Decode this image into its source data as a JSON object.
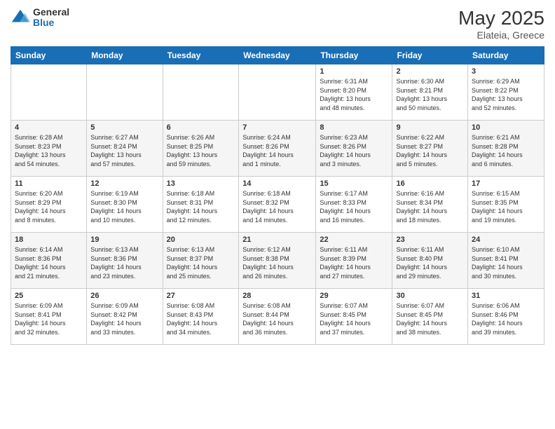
{
  "header": {
    "logo_general": "General",
    "logo_blue": "Blue",
    "month_year": "May 2025",
    "location": "Elateia, Greece"
  },
  "calendar": {
    "days_of_week": [
      "Sunday",
      "Monday",
      "Tuesday",
      "Wednesday",
      "Thursday",
      "Friday",
      "Saturday"
    ],
    "weeks": [
      [
        {
          "day": "",
          "info": ""
        },
        {
          "day": "",
          "info": ""
        },
        {
          "day": "",
          "info": ""
        },
        {
          "day": "",
          "info": ""
        },
        {
          "day": "1",
          "info": "Sunrise: 6:31 AM\nSunset: 8:20 PM\nDaylight: 13 hours\nand 48 minutes."
        },
        {
          "day": "2",
          "info": "Sunrise: 6:30 AM\nSunset: 8:21 PM\nDaylight: 13 hours\nand 50 minutes."
        },
        {
          "day": "3",
          "info": "Sunrise: 6:29 AM\nSunset: 8:22 PM\nDaylight: 13 hours\nand 52 minutes."
        }
      ],
      [
        {
          "day": "4",
          "info": "Sunrise: 6:28 AM\nSunset: 8:23 PM\nDaylight: 13 hours\nand 54 minutes."
        },
        {
          "day": "5",
          "info": "Sunrise: 6:27 AM\nSunset: 8:24 PM\nDaylight: 13 hours\nand 57 minutes."
        },
        {
          "day": "6",
          "info": "Sunrise: 6:26 AM\nSunset: 8:25 PM\nDaylight: 13 hours\nand 59 minutes."
        },
        {
          "day": "7",
          "info": "Sunrise: 6:24 AM\nSunset: 8:26 PM\nDaylight: 14 hours\nand 1 minute."
        },
        {
          "day": "8",
          "info": "Sunrise: 6:23 AM\nSunset: 8:26 PM\nDaylight: 14 hours\nand 3 minutes."
        },
        {
          "day": "9",
          "info": "Sunrise: 6:22 AM\nSunset: 8:27 PM\nDaylight: 14 hours\nand 5 minutes."
        },
        {
          "day": "10",
          "info": "Sunrise: 6:21 AM\nSunset: 8:28 PM\nDaylight: 14 hours\nand 6 minutes."
        }
      ],
      [
        {
          "day": "11",
          "info": "Sunrise: 6:20 AM\nSunset: 8:29 PM\nDaylight: 14 hours\nand 8 minutes."
        },
        {
          "day": "12",
          "info": "Sunrise: 6:19 AM\nSunset: 8:30 PM\nDaylight: 14 hours\nand 10 minutes."
        },
        {
          "day": "13",
          "info": "Sunrise: 6:18 AM\nSunset: 8:31 PM\nDaylight: 14 hours\nand 12 minutes."
        },
        {
          "day": "14",
          "info": "Sunrise: 6:18 AM\nSunset: 8:32 PM\nDaylight: 14 hours\nand 14 minutes."
        },
        {
          "day": "15",
          "info": "Sunrise: 6:17 AM\nSunset: 8:33 PM\nDaylight: 14 hours\nand 16 minutes."
        },
        {
          "day": "16",
          "info": "Sunrise: 6:16 AM\nSunset: 8:34 PM\nDaylight: 14 hours\nand 18 minutes."
        },
        {
          "day": "17",
          "info": "Sunrise: 6:15 AM\nSunset: 8:35 PM\nDaylight: 14 hours\nand 19 minutes."
        }
      ],
      [
        {
          "day": "18",
          "info": "Sunrise: 6:14 AM\nSunset: 8:36 PM\nDaylight: 14 hours\nand 21 minutes."
        },
        {
          "day": "19",
          "info": "Sunrise: 6:13 AM\nSunset: 8:36 PM\nDaylight: 14 hours\nand 23 minutes."
        },
        {
          "day": "20",
          "info": "Sunrise: 6:13 AM\nSunset: 8:37 PM\nDaylight: 14 hours\nand 25 minutes."
        },
        {
          "day": "21",
          "info": "Sunrise: 6:12 AM\nSunset: 8:38 PM\nDaylight: 14 hours\nand 26 minutes."
        },
        {
          "day": "22",
          "info": "Sunrise: 6:11 AM\nSunset: 8:39 PM\nDaylight: 14 hours\nand 27 minutes."
        },
        {
          "day": "23",
          "info": "Sunrise: 6:11 AM\nSunset: 8:40 PM\nDaylight: 14 hours\nand 29 minutes."
        },
        {
          "day": "24",
          "info": "Sunrise: 6:10 AM\nSunset: 8:41 PM\nDaylight: 14 hours\nand 30 minutes."
        }
      ],
      [
        {
          "day": "25",
          "info": "Sunrise: 6:09 AM\nSunset: 8:41 PM\nDaylight: 14 hours\nand 32 minutes."
        },
        {
          "day": "26",
          "info": "Sunrise: 6:09 AM\nSunset: 8:42 PM\nDaylight: 14 hours\nand 33 minutes."
        },
        {
          "day": "27",
          "info": "Sunrise: 6:08 AM\nSunset: 8:43 PM\nDaylight: 14 hours\nand 34 minutes."
        },
        {
          "day": "28",
          "info": "Sunrise: 6:08 AM\nSunset: 8:44 PM\nDaylight: 14 hours\nand 36 minutes."
        },
        {
          "day": "29",
          "info": "Sunrise: 6:07 AM\nSunset: 8:45 PM\nDaylight: 14 hours\nand 37 minutes."
        },
        {
          "day": "30",
          "info": "Sunrise: 6:07 AM\nSunset: 8:45 PM\nDaylight: 14 hours\nand 38 minutes."
        },
        {
          "day": "31",
          "info": "Sunrise: 6:06 AM\nSunset: 8:46 PM\nDaylight: 14 hours\nand 39 minutes."
        }
      ]
    ]
  }
}
